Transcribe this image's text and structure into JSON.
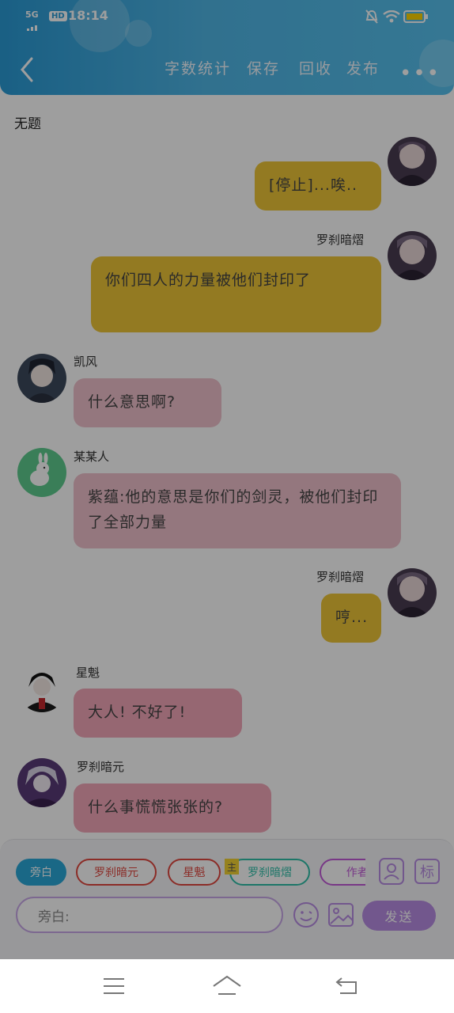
{
  "status_bar": {
    "network": "5G",
    "hd": "HD",
    "time": "18:14",
    "battery_icon": "battery-icon"
  },
  "header": {
    "back_icon": "chevron-left-icon",
    "nav": [
      "字数统计",
      "保存",
      "回收",
      "发布"
    ],
    "more_icon": "more-dots-icon"
  },
  "doc_title": "无题",
  "messages": [
    {
      "name": "",
      "text": "[停止]...唉..",
      "side": "right",
      "color": "gold"
    },
    {
      "name": "罗刹暗熠",
      "text": "你们四人的力量被他们封印了",
      "side": "right",
      "color": "gold"
    },
    {
      "name": "凯风",
      "text": "什么意思啊?",
      "side": "left",
      "color": "pink"
    },
    {
      "name": "某某人",
      "text": "紫蕴:他的意思是你们的剑灵，被他们封印了全部力量",
      "side": "left",
      "color": "pink"
    },
    {
      "name": "罗刹暗熠",
      "text": "哼...",
      "side": "right",
      "color": "gold"
    },
    {
      "name": "星魁",
      "text": "大人! 不好了!",
      "side": "left",
      "color": "pinkDeep"
    },
    {
      "name": "罗刹暗元",
      "text": "什么事慌慌张张的?",
      "side": "left",
      "color": "pinkDeep"
    }
  ],
  "bottom_panel": {
    "chips": [
      {
        "label": "旁白",
        "selected": true
      },
      {
        "label": "罗刹暗元",
        "selected": false
      },
      {
        "label": "星魁",
        "selected": false
      },
      {
        "label": "罗刹暗熠",
        "selected": false,
        "badge": "主"
      },
      {
        "label": "作者·",
        "selected": false
      }
    ],
    "person_icon": "person-card-icon",
    "tag_label": "标",
    "input_placeholder": "旁白:",
    "emoji_icon": "emoji-icon",
    "image_icon": "image-icon",
    "send_label": "发送"
  },
  "system_nav": {
    "menu_icon": "menu-icon",
    "home_icon": "home-icon",
    "back_icon": "back-icon"
  },
  "colors": {
    "header": "#2a9bd6",
    "gold_bubble": "#eec537",
    "pink_bubble": "#efc1cb",
    "accent": "#b88de4"
  }
}
